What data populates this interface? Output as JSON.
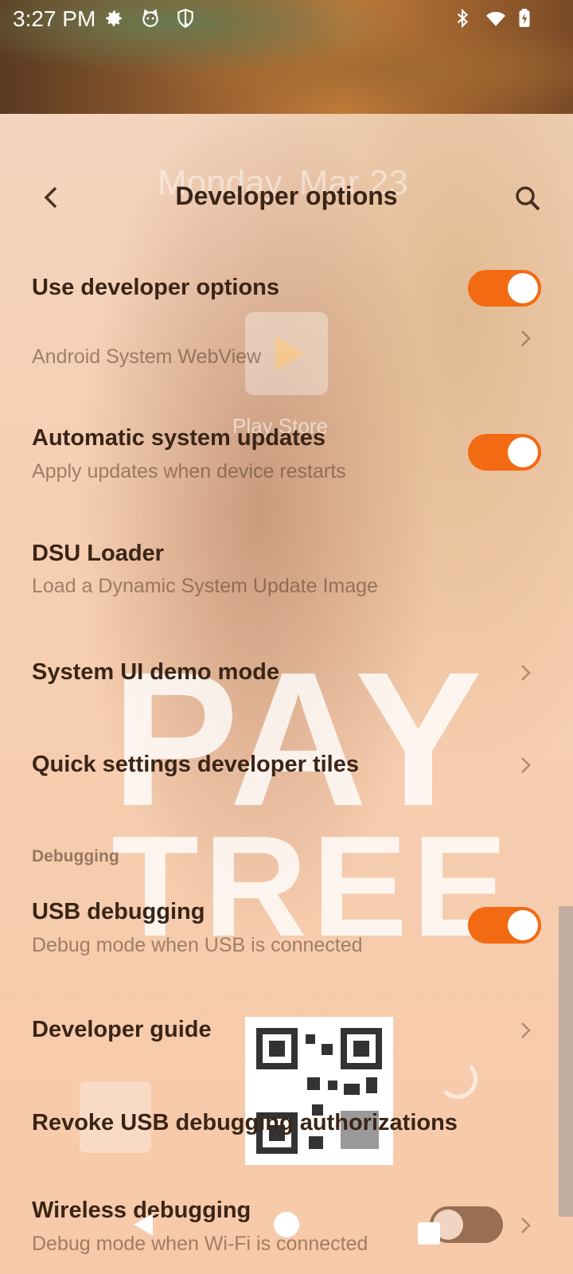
{
  "status_bar": {
    "time": "3:27 PM",
    "icons": [
      "gear-icon",
      "cat-icon",
      "shield-icon",
      "bluetooth-icon",
      "wifi-icon",
      "battery-charging-icon"
    ]
  },
  "overlay": {
    "date_text": "Monday, Mar 23",
    "play_store_label": "Play Store",
    "brand_line1": "PAY",
    "brand_line2": "TREE"
  },
  "header": {
    "title": "Developer options"
  },
  "settings": {
    "use_developer_options": {
      "title": "Use developer options",
      "enabled": true
    },
    "webview": {
      "subtitle": "Android System WebView"
    },
    "automatic_updates": {
      "title": "Automatic system updates",
      "subtitle": "Apply updates when device restarts",
      "enabled": true
    },
    "dsu_loader": {
      "title": "DSU Loader",
      "subtitle": "Load a Dynamic System Update Image"
    },
    "system_ui_demo": {
      "title": "System UI demo mode"
    },
    "quick_settings": {
      "title": "Quick settings developer tiles"
    },
    "debugging_section": "Debugging",
    "usb_debugging": {
      "title": "USB debugging",
      "subtitle": "Debug mode when USB is connected",
      "enabled": true
    },
    "developer_guide": {
      "title": "Developer guide"
    },
    "revoke_usb": {
      "title": "Revoke USB debugging authorizations"
    },
    "wireless_debugging": {
      "title": "Wireless debugging",
      "subtitle": "Debug mode when Wi-Fi is connected",
      "enabled": false
    }
  },
  "colors": {
    "accent": "#f26a12"
  }
}
